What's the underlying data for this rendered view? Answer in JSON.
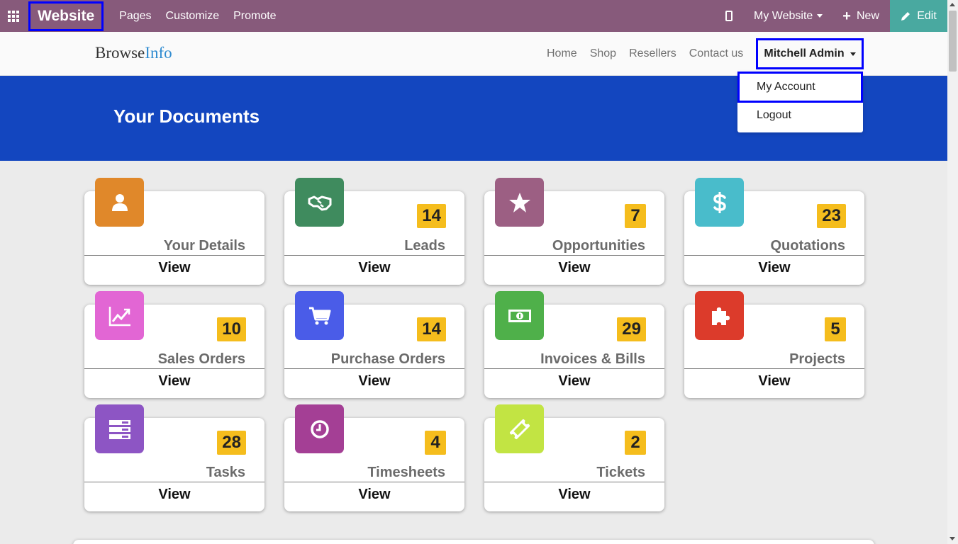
{
  "topbar": {
    "apps_icon": "apps-grid-icon",
    "brand": "Website",
    "nav": [
      "Pages",
      "Customize",
      "Promote"
    ],
    "mobile_icon": "mobile-preview-icon",
    "website_selector": "My Website",
    "new_label": "New",
    "edit_label": "Edit",
    "bar_color": "#875a7b",
    "edit_color": "#49a9a0"
  },
  "site_header": {
    "logo_part1": "Browse",
    "logo_part2": "Info",
    "nav": [
      "Home",
      "Shop",
      "Resellers",
      "Contact us"
    ],
    "user": "Mitchell Admin"
  },
  "user_dropdown": {
    "items": [
      "My Account",
      "Logout"
    ]
  },
  "banner": {
    "title": "Your Documents",
    "color": "#1346bf"
  },
  "cards": [
    {
      "label": "Your Details",
      "count": "",
      "icon": "user-icon",
      "color": "#e0882a",
      "view": "View"
    },
    {
      "label": "Leads",
      "count": "14",
      "icon": "handshake-icon",
      "color": "#3f8b5e",
      "view": "View"
    },
    {
      "label": "Opportunities",
      "count": "7",
      "icon": "star-icon",
      "color": "#9c5f83",
      "view": "View"
    },
    {
      "label": "Quotations",
      "count": "23",
      "icon": "dollar-icon",
      "color": "#49bccb",
      "view": "View"
    },
    {
      "label": "Sales Orders",
      "count": "10",
      "icon": "line-chart-icon",
      "color": "#e266d4",
      "view": "View"
    },
    {
      "label": "Purchase Orders",
      "count": "14",
      "icon": "shopping-cart-icon",
      "color": "#4a5ce8",
      "view": "View"
    },
    {
      "label": "Invoices & Bills",
      "count": "29",
      "icon": "money-icon",
      "color": "#4fb04a",
      "view": "View"
    },
    {
      "label": "Projects",
      "count": "5",
      "icon": "puzzle-icon",
      "color": "#dc3b2b",
      "view": "View"
    },
    {
      "label": "Tasks",
      "count": "28",
      "icon": "tasks-icon",
      "color": "#8d55c4",
      "view": "View"
    },
    {
      "label": "Timesheets",
      "count": "4",
      "icon": "clock-icon",
      "color": "#a43f95",
      "view": "View"
    },
    {
      "label": "Tickets",
      "count": "2",
      "icon": "ticket-icon",
      "color": "#c2e443",
      "view": "View"
    }
  ]
}
